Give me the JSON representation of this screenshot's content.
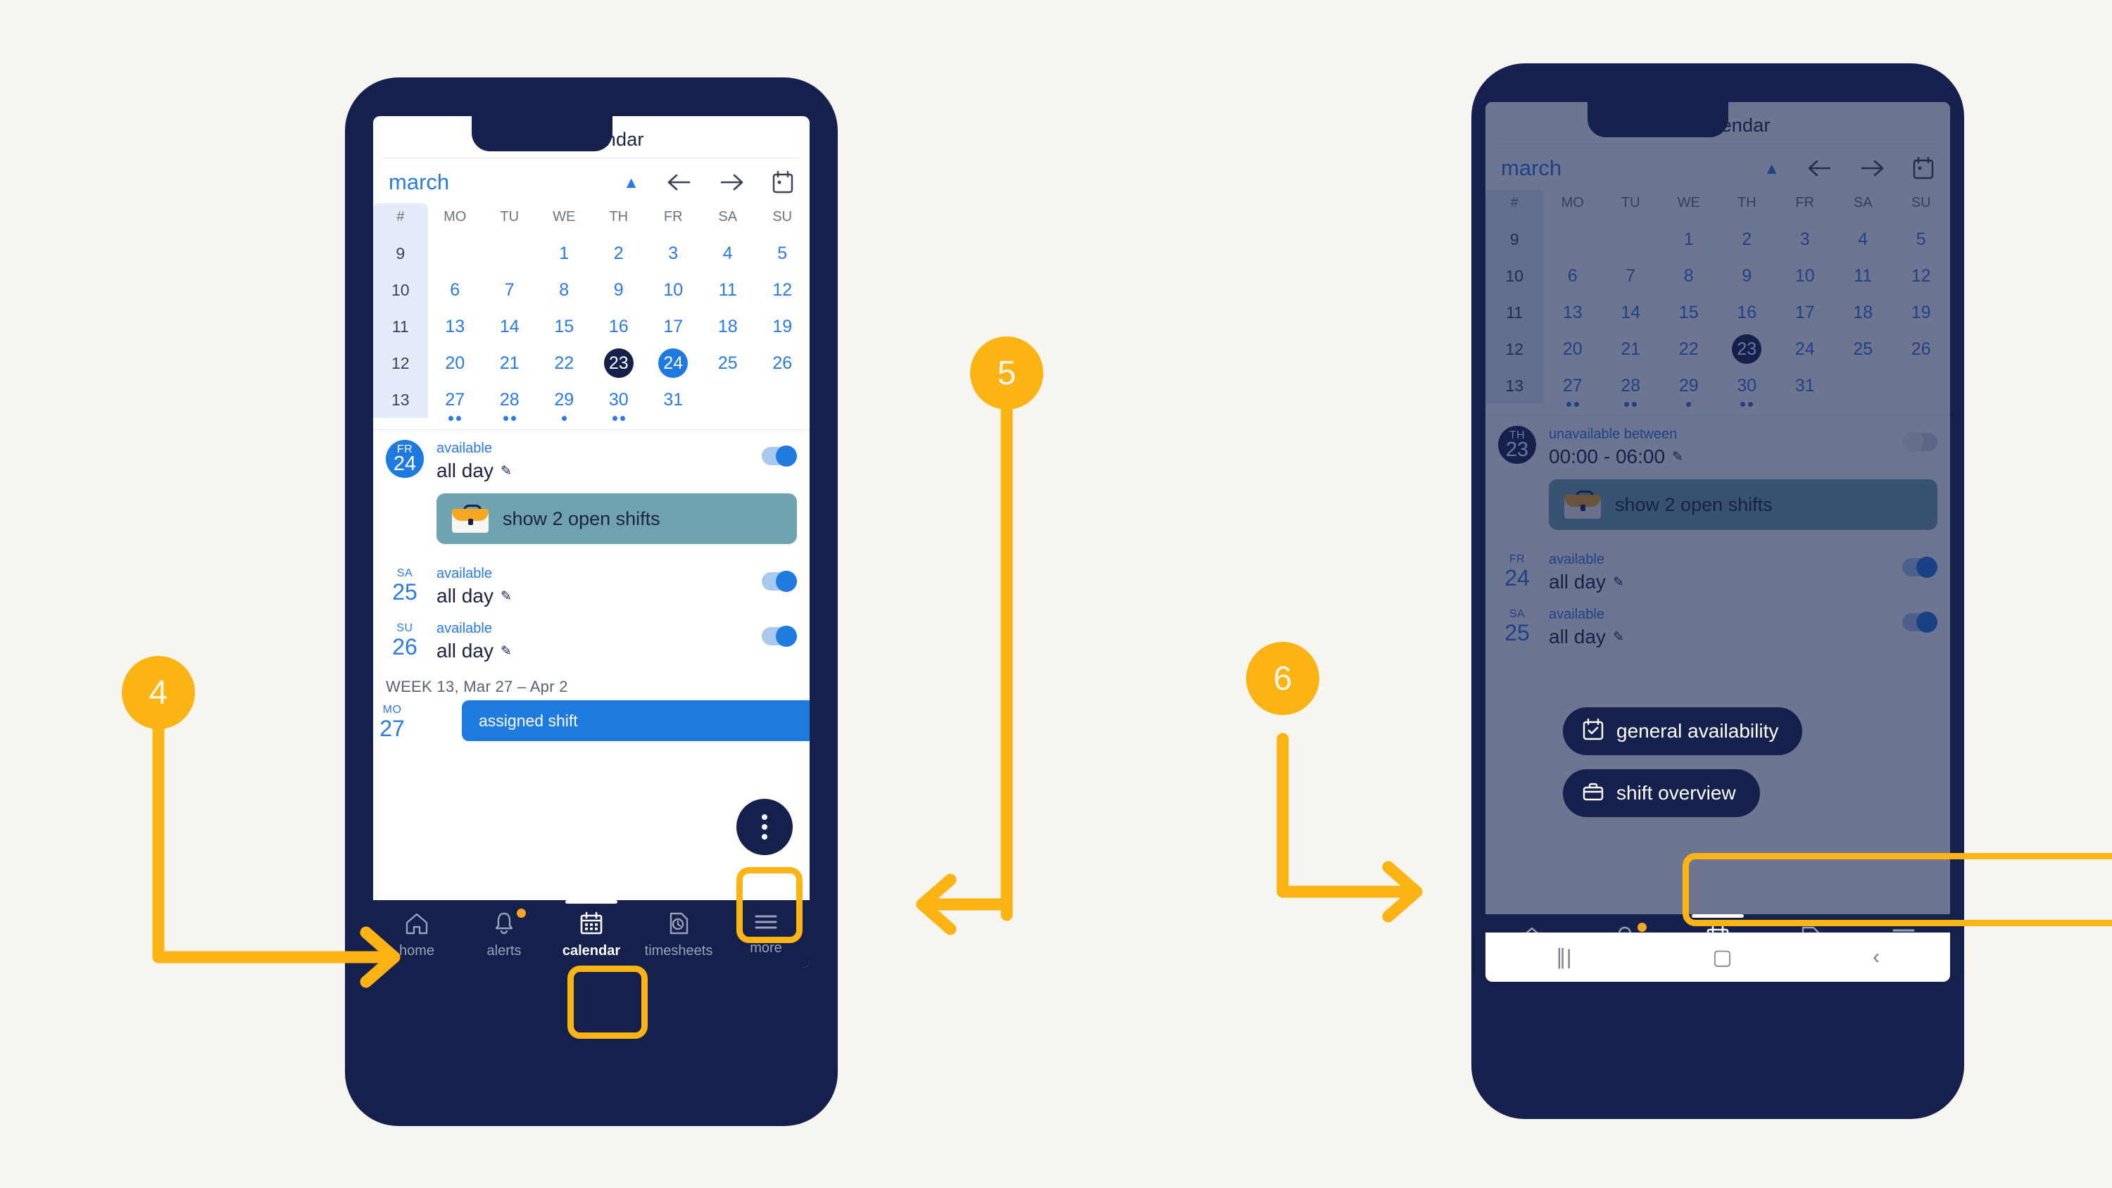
{
  "app": {
    "title": "my calendar",
    "month": "march",
    "weekday_headers": [
      "#",
      "MO",
      "TU",
      "WE",
      "TH",
      "FR",
      "SA",
      "SU"
    ],
    "week_numbers": [
      "9",
      "10",
      "11",
      "12",
      "13"
    ],
    "weeks": [
      [
        "",
        "",
        "1",
        "2",
        "3",
        "4",
        "5"
      ],
      [
        "6",
        "7",
        "8",
        "9",
        "10",
        "11",
        "12"
      ],
      [
        "13",
        "14",
        "15",
        "16",
        "17",
        "18",
        "19"
      ],
      [
        "20",
        "21",
        "22",
        "23",
        "24",
        "25",
        "26"
      ],
      [
        "27",
        "28",
        "29",
        "30",
        "31",
        "",
        ""
      ]
    ],
    "today": "23",
    "selected_phone1": "24",
    "selected_phone2": "23",
    "event_dots": {
      "27": 2,
      "28": 2,
      "29": 1,
      "30": 2
    },
    "icons": {
      "collapse": "chevron-up-icon",
      "prev": "arrow-left-icon",
      "next": "arrow-right-icon",
      "today": "calendar-today-icon",
      "edit": "pencil-icon",
      "briefcase": "briefcase-icon"
    }
  },
  "phone1": {
    "events": [
      {
        "weekday": "FR",
        "day": "24",
        "status": "available",
        "time": "all day",
        "toggle": "on",
        "badge_style": "circle"
      },
      {
        "weekday": "SA",
        "day": "25",
        "status": "available",
        "time": "all day",
        "toggle": "on",
        "badge_style": "plain"
      },
      {
        "weekday": "SU",
        "day": "26",
        "status": "available",
        "time": "all day",
        "toggle": "on",
        "badge_style": "plain"
      }
    ],
    "open_shifts_label": "show 2 open shifts",
    "week_label": "WEEK 13, Mar 27 – Apr 2",
    "next_week_row": {
      "weekday": "MO",
      "day": "27",
      "shift_label": "assigned shift"
    },
    "fab": "more-options"
  },
  "phone2": {
    "events": [
      {
        "weekday": "TH",
        "day": "23",
        "status": "unavailable between",
        "time": "00:00 - 06:00",
        "toggle": "off",
        "badge_style": "darkcircle"
      },
      {
        "weekday": "FR",
        "day": "24",
        "status": "available",
        "time": "all day",
        "toggle": "on",
        "badge_style": "plain"
      },
      {
        "weekday": "SA",
        "day": "25",
        "status": "available",
        "time": "all day",
        "toggle": "on",
        "badge_style": "plain"
      }
    ],
    "open_shifts_label": "show 2 open shifts",
    "menu": [
      {
        "label": "general availability",
        "icon": "calendar-check-icon"
      },
      {
        "label": "shift overview",
        "icon": "briefcase-icon"
      }
    ],
    "android_nav": [
      "recents",
      "home",
      "back"
    ]
  },
  "bottom_nav": [
    {
      "label": "home",
      "icon": "home-icon",
      "active": false,
      "badge": false
    },
    {
      "label": "alerts",
      "icon": "bell-icon",
      "active": false,
      "badge": true
    },
    {
      "label": "calendar",
      "icon": "calendar-icon",
      "active": true,
      "badge": false
    },
    {
      "label": "timesheets",
      "icon": "clock-document-icon",
      "active": false,
      "badge": false
    },
    {
      "label": "more",
      "icon": "hamburger-icon",
      "active": false,
      "badge": false
    }
  ],
  "annotations": {
    "steps": [
      {
        "number": "4",
        "target": "bottom-nav-calendar-tab"
      },
      {
        "number": "5",
        "target": "more-options-fab"
      },
      {
        "number": "6",
        "target": "shift-overview-menu-item"
      }
    ]
  },
  "colors": {
    "background": "#f7f5ef",
    "navy": "#15204d",
    "blue": "#1f7ae0",
    "link_blue": "#2a7ae2",
    "accent_orange": "#fcb415",
    "teal": "#6fa3b0",
    "yellow": "#f5a623"
  }
}
